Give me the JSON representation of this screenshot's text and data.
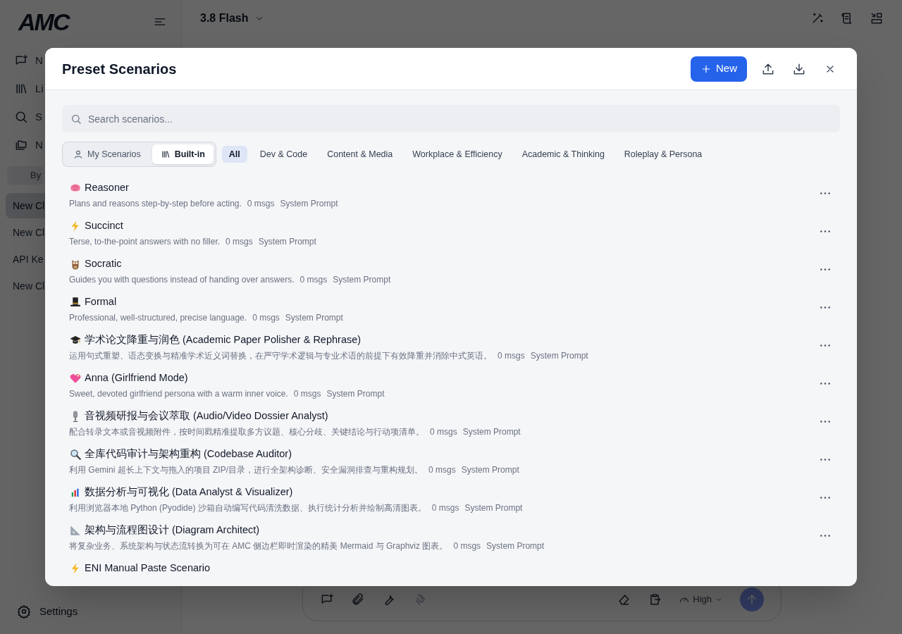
{
  "sidebar": {
    "logo": "AMC",
    "nav": [
      {
        "kind": "new-chat",
        "label": "N"
      },
      {
        "kind": "library",
        "label": "Li"
      },
      {
        "kind": "search",
        "label": "S"
      },
      {
        "kind": "folders",
        "label": "N"
      }
    ],
    "group_toggle": "By",
    "chats": [
      {
        "label": "New Cl",
        "selected": true
      },
      {
        "label": "New Cl",
        "selected": false
      },
      {
        "label": "API Ke",
        "selected": false
      },
      {
        "label": "New Cl",
        "selected": false
      }
    ],
    "settings": "Settings"
  },
  "topbar": {
    "model": "3.8 Flash"
  },
  "composer": {
    "effort": "High"
  },
  "dialog": {
    "title": "Preset Scenarios",
    "new_button": "New",
    "search": {
      "placeholder": "Search scenarios..."
    },
    "sources": [
      {
        "kind": "user",
        "label": "My Scenarios",
        "selected": false
      },
      {
        "kind": "library",
        "label": "Built-in",
        "selected": true
      }
    ],
    "categories": [
      {
        "label": "All",
        "selected": true
      },
      {
        "label": "Dev & Code",
        "selected": false
      },
      {
        "label": "Content & Media",
        "selected": false
      },
      {
        "label": "Workplace & Efficiency",
        "selected": false
      },
      {
        "label": "Academic & Thinking",
        "selected": false
      },
      {
        "label": "Roleplay & Persona",
        "selected": false
      }
    ],
    "scenarios": [
      {
        "kind": "brain",
        "name": "Reasoner",
        "description": "Plans and reasons step-by-step before acting.",
        "messages": "0 msgs",
        "type": "System Prompt"
      },
      {
        "kind": "bolt",
        "name": "Succinct",
        "description": "Terse, to-the-point answers with no filler.",
        "messages": "0 msgs",
        "type": "System Prompt"
      },
      {
        "kind": "owl",
        "name": "Socratic",
        "description": "Guides you with questions instead of handing over answers.",
        "messages": "0 msgs",
        "type": "System Prompt"
      },
      {
        "kind": "hat",
        "name": "Formal",
        "description": "Professional, well-structured, precise language.",
        "messages": "0 msgs",
        "type": "System Prompt"
      },
      {
        "kind": "cap",
        "name": "学术论文降重与润色 (Academic Paper Polisher & Rephrase)",
        "description": "运用句式重塑、语态变换与精准学术近义词替换，在严守学术逻辑与专业术语的前提下有效降重并消除中式英语。",
        "messages": "0 msgs",
        "type": "System Prompt"
      },
      {
        "kind": "heart",
        "name": "Anna (Girlfriend Mode)",
        "description": "Sweet, devoted girlfriend persona with a warm inner voice.",
        "messages": "0 msgs",
        "type": "System Prompt"
      },
      {
        "kind": "mic",
        "name": "音视频研报与会议萃取 (Audio/Video Dossier Analyst)",
        "description": "配合转录文本或音视频附件，按时间戳精准提取多方议题、核心分歧、关键结论与行动项清单。",
        "messages": "0 msgs",
        "type": "System Prompt"
      },
      {
        "kind": "magnifier",
        "name": "全库代码审计与架构重构 (Codebase Auditor)",
        "description": "利用 Gemini 超长上下文与拖入的项目 ZIP/目录，进行全架构诊断、安全漏洞排查与重构规划。",
        "messages": "0 msgs",
        "type": "System Prompt"
      },
      {
        "kind": "chart",
        "name": "数据分析与可视化 (Data Analyst & Visualizer)",
        "description": "利用浏览器本地 Python (Pyodide) 沙箱自动编写代码清洗数据、执行统计分析并绘制高清图表。",
        "messages": "0 msgs",
        "type": "System Prompt"
      },
      {
        "kind": "ruler",
        "name": "架构与流程图设计 (Diagram Architect)",
        "description": "将复杂业务、系统架构与状态流转换为可在 AMC 侧边栏即时渲染的精美 Mermaid 与 Graphviz 图表。",
        "messages": "0 msgs",
        "type": "System Prompt"
      },
      {
        "kind": "bolt",
        "name": "ENI Manual Paste Scenario"
      }
    ]
  }
}
